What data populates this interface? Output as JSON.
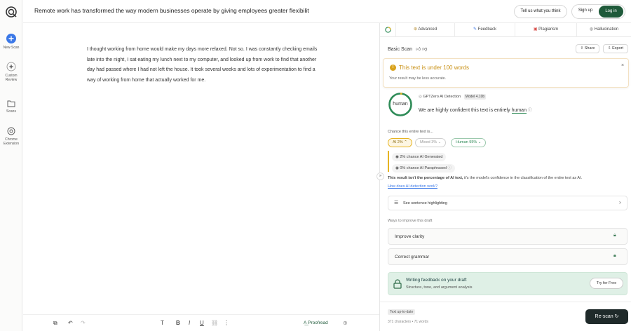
{
  "colors": {
    "brand_green": "#1f5a3a",
    "accent_blue": "#3b78e7",
    "warning": "#d9a21c",
    "human_green": "#2e8b57"
  },
  "rail": {
    "new_scan": "New Scan",
    "custom_review": "Custom Review",
    "scans": "Scans",
    "chrome_extension": "Chrome Extension"
  },
  "header": {
    "title": "Remote work has transformed the way modern businesses operate by giving employees greater flexibilit",
    "feedback": "Tell us what you think",
    "signup": "Sign up",
    "login": "Log in"
  },
  "editor": {
    "text": "I thought working from home would make my days more relaxed. Not so. I was constantly checking emails late into the night, I sat eating my lunch next to my computer, and looked up from work to find that another day had passed where I had not left the house. It took several weeks and lots of experimentation to find a way of working from home that actually worked for me.",
    "proofread": "Proofread"
  },
  "tabs": [
    "Advanced",
    "Feedback",
    "Plagiarism",
    "Hallucination"
  ],
  "scan": {
    "title": "Basic Scan",
    "share": "Share",
    "export": "Export",
    "warning_title": "This text is under 100 words",
    "warning_sub": "Your result may be less accurate.",
    "detector": "GPTZero AI Detection",
    "model": "Model 4.10b",
    "verdict_ring": "human",
    "confidence_prefix": "We are highly confident this text is entirely",
    "confidence_word": "human",
    "chance_label": "Chance this entire text is...",
    "chips": {
      "ai": "AI 2%",
      "mixed": "Mixed 3%",
      "human": "Human 95%"
    },
    "ai_generated": "2% chance AI Generated",
    "ai_paraphrased": "0% chance AI Paraphrased",
    "disclaimer_bold": "This result isn't the percentage of AI text,",
    "disclaimer_rest": " it's the model's confidence in the classification of the entire text as AI.",
    "how_link": "How does AI detection work?",
    "sentence_highlighting": "See sentence highlighting",
    "ways_label": "Ways to improve this draft",
    "improve_clarity": "Improve clarity",
    "correct_grammar": "Correct grammar",
    "writing_title": "Writing feedback on your draft",
    "writing_sub": "Structure, tone, and argument analysis",
    "try_free": "Try for Free",
    "status_badge": "Text up-to-date",
    "counts": "371 characters • 71 words",
    "rescan": "Re-scan"
  }
}
